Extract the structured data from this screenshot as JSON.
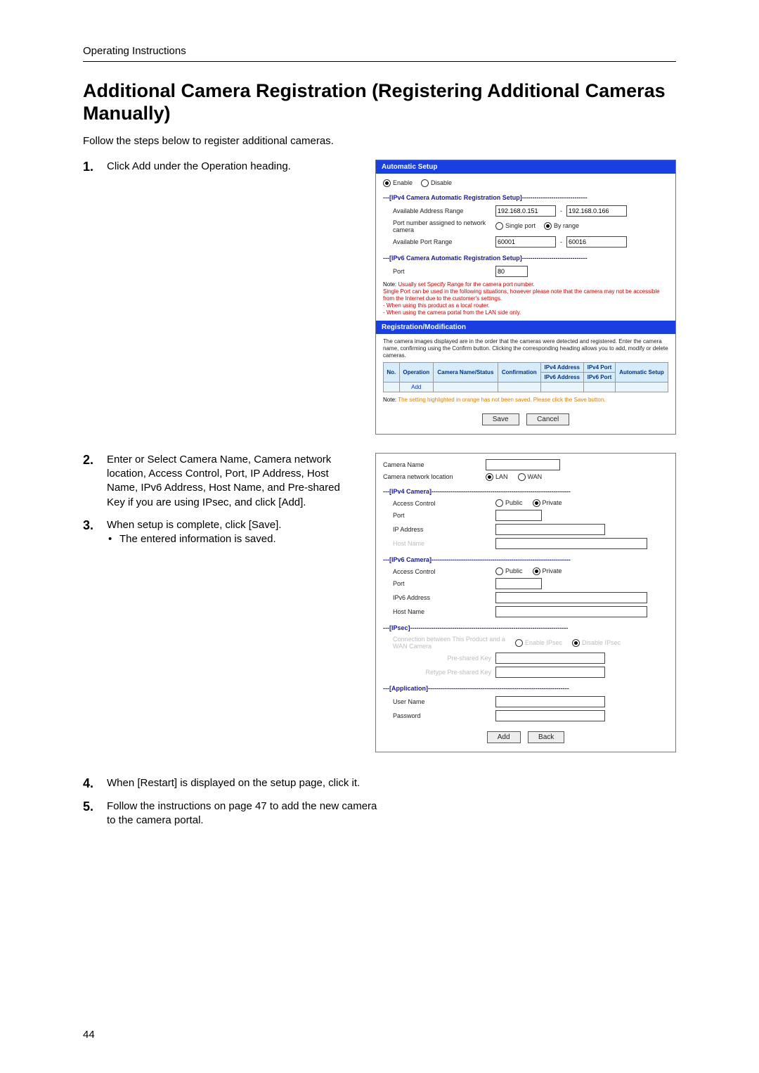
{
  "doc": {
    "running_head": "Operating Instructions",
    "title": "Additional Camera Registration (Registering Additional Cameras Manually)",
    "intro": "Follow the steps below to register additional cameras.",
    "page_number": "44"
  },
  "steps": {
    "s1n": "1.",
    "s1": "Click Add under the Operation heading.",
    "s2n": "2.",
    "s2": "Enter or Select Camera Name, Camera network location, Access Control, Port, IP Address, Host Name, IPv6 Address, Host Name, and Pre-shared Key if you are using IPsec, and click [Add].",
    "s3n": "3.",
    "s3": "When setup is complete, click [Save].",
    "s3b": "The entered information is saved.",
    "s4n": "4.",
    "s4": "When [Restart] is displayed on the setup page, click it.",
    "s5n": "5.",
    "s5": "Follow the instructions on page 47 to add the new camera to the camera portal."
  },
  "panel1": {
    "title": "Automatic Setup",
    "enable": "Enable",
    "disable": "Disable",
    "sec1": "---[IPv4 Camera Automatic Registration Setup]-------------------------------",
    "addr_range_lbl": "Available Address Range",
    "addr_from": "192.168.0.151",
    "addr_dash": "-",
    "addr_to": "192.168.0.166",
    "port_assign_lbl": "Port number assigned to network camera",
    "single_port": "Single port",
    "by_range": "By range",
    "avail_port_lbl": "Available Port Range",
    "port_from": "60001",
    "port_to": "60016",
    "sec2": "---[IPv6 Camera Automatic Registration Setup]-------------------------------",
    "v6port_lbl": "Port",
    "v6port_val": "80",
    "note1_head": "Note:",
    "note1_body": " Usually set Specify Range for the camera port number.\nSingle Port can be used in the following situations, however please note that the camera may not be accessible from the Internet due to the customer's settings.\n- When using this product as a local router.\n- When using the camera portal from the LAN side only.",
    "regmod": "Registration/Modification",
    "regmod_text": "The camera images displayed are in the order that the cameras were detected and registered. Enter the camera name, confirming using the Confirm button. Clicking the corresponding heading allows you to add, modify or delete cameras.",
    "th_no": "No.",
    "th_op": "Operation",
    "th_name": "Camera Name/Status",
    "th_conf": "Confirmation",
    "th_v4a": "IPv4 Address",
    "th_v4p": "IPv4 Port",
    "th_v6a": "IPv6 Address",
    "th_v6p": "IPv6 Port",
    "th_auto": "Automatic Setup",
    "add_link": "Add",
    "save_note_head": "Note:",
    "save_note": " The setting highlighted in orange has not been saved. Please click the Save button.",
    "btn_save": "Save",
    "btn_cancel": "Cancel"
  },
  "panel2": {
    "cam_name": "Camera Name",
    "cam_loc": "Camera network location",
    "lan": "LAN",
    "wan": "WAN",
    "sec_v4": "---[IPv4 Camera]------------------------------------------------------------------",
    "access": "Access Control",
    "public": "Public",
    "private": "Private",
    "port": "Port",
    "ipaddr": "IP Address",
    "host": "Host Name",
    "sec_v6": "---[IPv6 Camera]------------------------------------------------------------------",
    "ipv6addr": "IPv6 Address",
    "sec_ipsec": "---[IPsec]---------------------------------------------------------------------------",
    "conn": "Connection between This Product and a WAN Camera",
    "enable_ipsec": "Enable IPsec",
    "disable_ipsec": "Disable IPsec",
    "psk": "Pre-shared Key",
    "psk2": "Retype Pre-shared Key",
    "sec_app": "---[Application]-------------------------------------------------------------------",
    "user": "User Name",
    "pass": "Password",
    "btn_add": "Add",
    "btn_back": "Back"
  }
}
